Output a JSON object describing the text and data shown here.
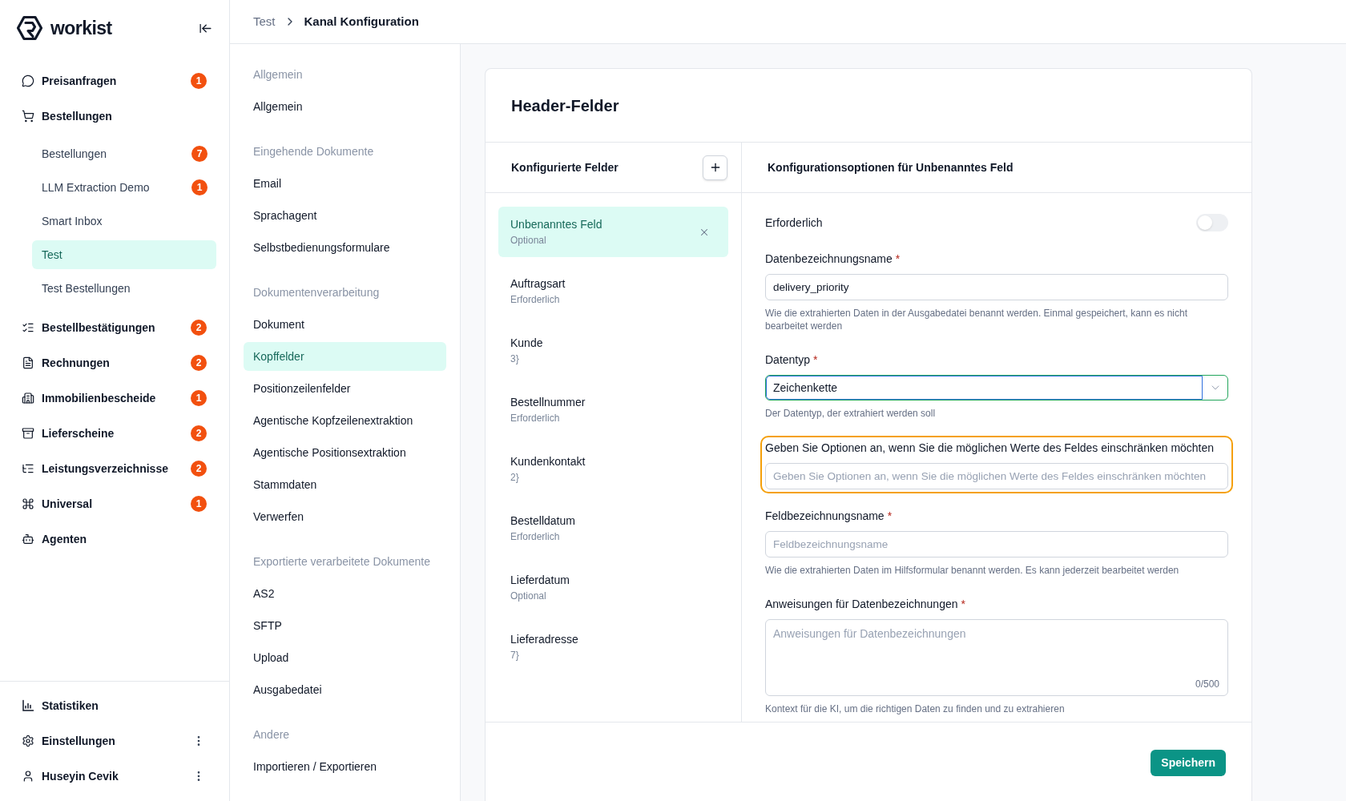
{
  "sidebar": {
    "logo_text": "workist",
    "nav": [
      {
        "label": "Preisanfragen",
        "badge": "1",
        "selected": false
      },
      {
        "label": "Bestellungen",
        "selected": false,
        "children": [
          {
            "label": "Bestellungen",
            "badge": "7",
            "selected": false
          },
          {
            "label": "LLM Extraction Demo",
            "badge": "1",
            "selected": false
          },
          {
            "label": "Smart Inbox",
            "selected": false
          },
          {
            "label": "Test",
            "selected": true
          },
          {
            "label": "Test Bestellungen",
            "selected": false
          }
        ]
      },
      {
        "label": "Bestellbestätigungen",
        "badge": "2",
        "selected": false
      },
      {
        "label": "Rechnungen",
        "badge": "2",
        "selected": false
      },
      {
        "label": "Immobilienbescheide",
        "badge": "1",
        "selected": false
      },
      {
        "label": "Lieferscheine",
        "badge": "2",
        "selected": false
      },
      {
        "label": "Leistungsverzeichnisse",
        "badge": "2",
        "selected": false
      },
      {
        "label": "Universal",
        "badge": "1",
        "selected": false
      },
      {
        "label": "Agenten",
        "selected": false
      }
    ],
    "footer": [
      {
        "label": "Statistiken",
        "menu": false
      },
      {
        "label": "Einstellungen",
        "menu": true
      },
      {
        "label": "Huseyin Cevik",
        "menu": true
      }
    ]
  },
  "breadcrumb": [
    "Test",
    "Kanal Konfiguration"
  ],
  "settings_nav": [
    {
      "heading": "Allgemein",
      "items": [
        {
          "label": "Allgemein",
          "selected": false
        }
      ]
    },
    {
      "heading": "Eingehende Dokumente",
      "items": [
        {
          "label": "Email",
          "selected": false
        },
        {
          "label": "Sprachagent",
          "selected": false
        },
        {
          "label": "Selbstbedienungsformulare",
          "selected": false
        }
      ]
    },
    {
      "heading": "Dokumentenverarbeitung",
      "items": [
        {
          "label": "Dokument",
          "selected": false
        },
        {
          "label": "Kopffelder",
          "selected": true
        },
        {
          "label": "Positionzeilenfelder",
          "selected": false
        },
        {
          "label": "Agentische Kopfzeilenextraktion",
          "selected": false
        },
        {
          "label": "Agentische Positionsextraktion",
          "selected": false
        },
        {
          "label": "Stammdaten",
          "selected": false
        },
        {
          "label": "Verwerfen",
          "selected": false
        }
      ]
    },
    {
      "heading": "Exportierte verarbeitete Dokumente",
      "items": [
        {
          "label": "AS2",
          "selected": false
        },
        {
          "label": "SFTP",
          "selected": false
        },
        {
          "label": "Upload",
          "selected": false
        },
        {
          "label": "Ausgabedatei",
          "selected": false
        }
      ]
    },
    {
      "heading": "Andere",
      "items": [
        {
          "label": "Importieren / Exportieren",
          "selected": false
        }
      ]
    }
  ],
  "card": {
    "title": "Header-Felder",
    "fields_panel": {
      "title": "Konfigurierte Felder",
      "items": [
        {
          "name": "Unbenanntes Feld",
          "status": "Optional",
          "selected": true
        },
        {
          "name": "Auftragsart",
          "status": "Erforderlich",
          "selected": false
        },
        {
          "name": "Kunde",
          "status": "3}",
          "selected": false
        },
        {
          "name": "Bestellnummer",
          "status": "Erforderlich",
          "selected": false
        },
        {
          "name": "Kundenkontakt",
          "status": "2}",
          "selected": false
        },
        {
          "name": "Bestelldatum",
          "status": "Erforderlich",
          "selected": false
        },
        {
          "name": "Lieferdatum",
          "status": "Optional",
          "selected": false
        },
        {
          "name": "Lieferadresse",
          "status": "7}",
          "selected": false
        }
      ]
    },
    "config_panel": {
      "title": "Konfigurationsoptionen für Unbenanntes Feld",
      "required_marker": "*",
      "form": [
        {
          "kind": "toggle",
          "label": "Erforderlich",
          "on": false,
          "required": false,
          "highlighted": false
        },
        {
          "kind": "text",
          "label": "Datenbezeichnungsname",
          "required": true,
          "highlighted": false,
          "value": "delivery_priority",
          "help": "Wie die extrahierten Daten in der Ausgabedatei benannt werden. Einmal gespeichert, kann es nicht bearbeitet werden"
        },
        {
          "kind": "select",
          "label": "Datentyp",
          "required": true,
          "highlighted": false,
          "value": "Zeichenkette",
          "help": "Der Datentyp, der extrahiert werden soll"
        },
        {
          "kind": "text",
          "label": "Geben Sie Optionen an, wenn Sie die möglichen Werte des Feldes einschränken möchten",
          "required": false,
          "highlighted": true,
          "placeholder": "Geben Sie Optionen an, wenn Sie die möglichen Werte des Feldes einschränken möchten"
        },
        {
          "kind": "text",
          "label": "Feldbezeichnungsname",
          "required": true,
          "highlighted": false,
          "placeholder": "Feldbezeichnungsname",
          "help": "Wie die extrahierten Daten im Hilfsformular benannt werden. Es kann jederzeit bearbeitet werden"
        },
        {
          "kind": "textarea",
          "label": "Anweisungen für Datenbezeichnungen",
          "required": true,
          "highlighted": false,
          "placeholder": "Anweisungen für Datenbezeichnungen",
          "counter": "0/500",
          "help": "Kontext für die KI, um die richtigen Daten zu finden und zu extrahieren"
        }
      ]
    },
    "save_button": "Speichern"
  }
}
